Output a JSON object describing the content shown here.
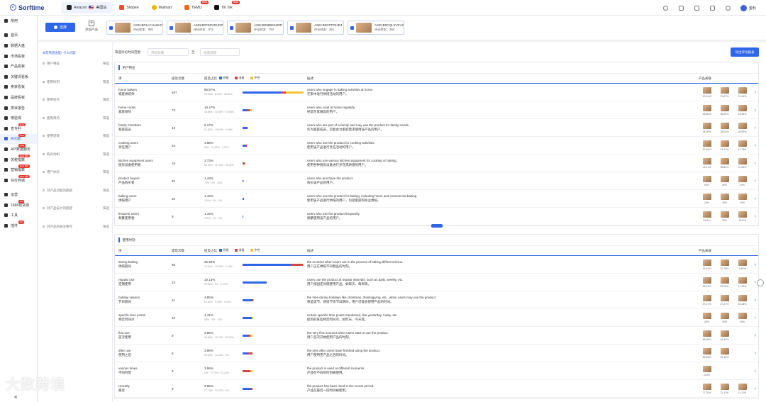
{
  "app": {
    "name": "Sorftime"
  },
  "tabs": [
    {
      "label": "Amazon",
      "sub": "美国站",
      "color": "#222"
    },
    {
      "label": "Shopee",
      "color": "#ee4d2d"
    },
    {
      "label": "Walmart",
      "color": "#f2b400"
    },
    {
      "label": "TEMU",
      "badge": "Beta",
      "color": "#f26522"
    },
    {
      "label": "Tik Tok",
      "badge": "Beta",
      "color": "#111"
    }
  ],
  "user": {
    "name": "金科"
  },
  "sidebar": {
    "items": [
      {
        "label": "常用"
      },
      {
        "label": "首页"
      },
      {
        "label": "数据大盘"
      },
      {
        "label": "市场看板"
      },
      {
        "label": "产品看板"
      },
      {
        "label": "关键词看板"
      },
      {
        "label": "卖家看板"
      },
      {
        "label": "品牌看板"
      },
      {
        "label": "类目报告"
      },
      {
        "label": "榜验得"
      },
      {
        "label": "查专利",
        "badge": "New"
      },
      {
        "label": "AI功能",
        "badge": "New"
      },
      {
        "label": "API数据服务",
        "badge": "New"
      },
      {
        "label": "关税指数",
        "badge": "New 5周"
      },
      {
        "label": "营销指数",
        "badge": "New 5周"
      },
      {
        "label": "任价商城",
        "badge": "New 5周"
      },
      {
        "label": "运营"
      },
      {
        "label": "1688找货源",
        "badge": "hot"
      },
      {
        "label": "工具"
      },
      {
        "label": "插件",
        "badge": "hot"
      }
    ]
  },
  "toolbar": {
    "choose_label": "选择",
    "add_label": "添加产品"
  },
  "products": [
    {
      "asin": "ASIN:B01ACUA8HC",
      "count_label": "评论样本：",
      "count": "905"
    },
    {
      "asin": "ASIN:B07DZVRURZ",
      "count_label": "评论样本：",
      "count": "872"
    },
    {
      "asin": "ASIN:B098B5S4RR",
      "count_label": "评论样本：",
      "count": "783"
    },
    {
      "asin": "ASIN:B0CFTP6JR4",
      "count_label": "评论样本：",
      "count": "392"
    },
    {
      "asin": "ASIN:B0CQLXVKV2",
      "count_label": "评论样本：",
      "count": "386"
    }
  ],
  "left_panel": {
    "hint": "如何筛选维度? 什么问题",
    "rows": [
      {
        "label": "用户特征",
        "action": "筛选"
      },
      {
        "label": "使用时刻",
        "action": "筛选"
      },
      {
        "label": "使用地点",
        "action": "筛选"
      },
      {
        "label": "使用目的",
        "action": "筛选"
      },
      {
        "label": "使用场景",
        "action": "筛选"
      },
      {
        "label": "购买动机",
        "action": "筛选"
      },
      {
        "label": "用户体验",
        "action": "筛选"
      },
      {
        "label": "对产品功能的期望",
        "action": "筛选"
      },
      {
        "label": "对产品设计的期望",
        "action": "筛选"
      },
      {
        "label": "对产品的关注要点",
        "action": "筛选"
      }
    ]
  },
  "filter": {
    "label": "筛选评论时间范围",
    "start_placeholder": "开始日期",
    "to": "至",
    "end_placeholder": "结束日期",
    "export": "导出评论报表"
  },
  "table_headers": {
    "item": "项",
    "count": "提及次数",
    "pct": "提及占比",
    "desc": "描述",
    "products": "产品关联",
    "legend": [
      {
        "label": "积极",
        "color": "#2f66e8"
      },
      {
        "label": "消极",
        "color": "#d64541"
      },
      {
        "label": "中性",
        "color": "#f4c430"
      }
    ]
  },
  "sections": [
    {
      "title": "用户特征",
      "rows": [
        {
          "en": "home bakers",
          "zh": "家庭烘焙师",
          "count": "487",
          "pct": "85.57%",
          "sub": "63.03% · 8.16% · 28.81%",
          "pos": 0.63,
          "neg": 0.08,
          "neu": 0.29,
          "bar": 1.0,
          "desc_en": "users who engage in baking activities at home.",
          "desc_zh": "在家中进行烘焙活动的用户。",
          "prod": [
            "20.04%",
            "19.67%",
            "19.44%"
          ]
        },
        {
          "en": "home cooks",
          "zh": "家庭厨师",
          "count": "73",
          "pct": "10.47%",
          "sub": "46.58% · 32.88% · 20.55%",
          "pos": 0.47,
          "neg": 0.33,
          "neu": 0.2,
          "bar": 0.15,
          "desc_en": "users who cook at home regularly.",
          "desc_zh": "经常在家做饭的用户。",
          "prod": [
            "46.58%",
            "34.25%",
            "15.44%"
          ]
        },
        {
          "en": "family members",
          "zh": "家庭成员",
          "count": "43",
          "pct": "6.17%",
          "sub": "81.82% · 13.64% · 4.55%",
          "pos": 0.82,
          "neg": 0.14,
          "neu": 0.04,
          "bar": 0.09,
          "desc_en": "users who are part of a family and may use the product for family needs.",
          "desc_zh": "作为家庭成员，可能会为家庭需求使用该产品的用户。",
          "prod": [
            "25.00%",
            "25.00%",
            "20.93%"
          ]
        },
        {
          "en": "cooking users",
          "zh": "烹饪用户",
          "count": "34",
          "pct": "4.88%",
          "sub": "88% · 11.63% · 0.37%",
          "pos": 0.88,
          "neg": 0.12,
          "neu": 0.0,
          "bar": 0.07,
          "desc_en": "users who use the product for cooking activities.",
          "desc_zh": "使用该产品进行烹饪活动的用户。",
          "prod": [
            "67.65%",
            "14.71%",
            "11.76%"
          ]
        },
        {
          "en": "kitchen equipment users",
          "zh": "厨房设备使用者",
          "count": "19",
          "pct": "2.73%",
          "sub": "52.42% · 21.36% · 26.22%",
          "pos": 0.52,
          "neg": 0.21,
          "neu": 0.27,
          "bar": 0.05,
          "desc_en": "users who use various kitchen equipment for cooking or baking.",
          "desc_zh": "使用各种厨房设备进行烹饪或烘焙的用户。",
          "prod": [
            "42.11%",
            "36.84%",
            "21.05%"
          ]
        },
        {
          "en": "product buyers",
          "zh": "产品购买者",
          "count": "10",
          "pct": "1.43%",
          "sub": "70% · 0% · 30%",
          "pos": 0.7,
          "neg": 0.0,
          "neu": 0.3,
          "bar": 0.02,
          "desc_en": "users who purchase the product.",
          "desc_zh": "购买该产品的用户。",
          "prod": [
            "50%",
            "30%",
            "10%"
          ]
        },
        {
          "en": "baking users",
          "zh": "烘焙用户",
          "count": "10",
          "pct": "1.43%",
          "sub": "100% · 0% · 0%",
          "pos": 1.0,
          "neg": 0.0,
          "neu": 0.0,
          "bar": 0.02,
          "desc_en": "users who use the product for baking, including home and commercial baking.",
          "desc_zh": "使用该产品进行烘焙的用户，包括家庭和商业烘焙。",
          "prod": [
            "20%",
            "30%",
            "20%"
          ]
        },
        {
          "en": "frequent users",
          "zh": "频繁使用者",
          "count": "8",
          "pct": "1.15%",
          "sub": "100% · 0% · 0%",
          "pos": 1.0,
          "neg": 0.0,
          "neu": 0.0,
          "bar": 0.015,
          "desc_en": "users who use the product frequently.",
          "desc_zh": "频繁使用该产品的用户。",
          "prod": [
            "62.5%",
            "25%",
            "12.5%"
          ]
        }
      ]
    },
    {
      "title": "使用时刻",
      "rows": [
        {
          "en": "during baking",
          "zh": "烘焙期间",
          "count": "58",
          "pct": "25.55%",
          "sub": "79.09% · 20.95% · 0.19%",
          "pos": 0.79,
          "neg": 0.2,
          "neu": 0.01,
          "bar": 1.0,
          "desc_en": "the moment when users are in the process of baking different items.",
          "desc_zh": "用户正在烘焙不同物品的时刻。",
          "prod": [
            "32.07%",
            "32.79%",
            "3.45%"
          ]
        },
        {
          "en": "regular use",
          "zh": "定期使用",
          "count": "23",
          "pct": "10.13%",
          "sub": "99.68% · 0% · 0.32%",
          "pos": 1.0,
          "neg": 0.0,
          "neu": 0.0,
          "bar": 0.4,
          "desc_en": "users use the product at regular intervals, such as daily, weekly, etc.",
          "desc_zh": "用户按固定间隔使用产品，如每天、每周等。",
          "prod": [
            "36.43%",
            "26.09%",
            "17.39%"
          ]
        },
        {
          "en": "holiday season",
          "zh": "节日期间",
          "count": "11",
          "pct": "4.85%",
          "sub": "81.82% · 9.09% · 9.09%",
          "pos": 0.82,
          "neg": 0.09,
          "neu": 0.09,
          "bar": 0.19,
          "desc_en": "the time during holidays like christmas, thanksgiving, etc., when users may use the product.",
          "desc_zh": "像圣诞节、感恩节等节日期间，用户可能会使用产品的时间。",
          "prod": [
            "27.27%",
            "27.27%",
            "18.18%"
          ]
        },
        {
          "en": "specific time points",
          "zh": "特定时间点",
          "count": "10",
          "pct": "4.41%",
          "sub": "88% · 0% · 12%",
          "pos": 0.88,
          "neg": 0.0,
          "neu": 0.12,
          "bar": 0.17,
          "desc_en": "certain specific time points mentioned, like yesterday, today, etc.",
          "desc_zh": "提到的某些特定时间点，如昨天、今天等。",
          "prod": [
            "40%",
            "30%",
            "20%"
          ]
        },
        {
          "en": "first use",
          "zh": "首次使用",
          "count": "9",
          "pct": "3.96%",
          "sub": "55.56% · 22.22% · 22.22%",
          "pos": 0.56,
          "neg": 0.22,
          "neu": 0.22,
          "bar": 0.16,
          "desc_en": "the very first moment when users start to use the product.",
          "desc_zh": "用户首次开始使用产品的时刻。",
          "prod": [
            "55.56%",
            "44.44%"
          ]
        },
        {
          "en": "after use",
          "zh": "使用之后",
          "count": "9",
          "pct": "3.96%",
          "sub": "55.56% · 44.44% · 0%",
          "pos": 0.56,
          "neg": 0.44,
          "neu": 0.0,
          "bar": 0.16,
          "desc_en": "the time after users have finished using the product.",
          "desc_zh": "用户使用完产品之后的时间。",
          "prod": [
            "55.56%",
            "44.44%"
          ]
        },
        {
          "en": "various times",
          "zh": "不同时刻",
          "count": "9",
          "pct": "3.96%",
          "sub": "0% · 77.78% · 22.22%",
          "pos": 0.0,
          "neg": 0.78,
          "neu": 0.22,
          "bar": 0.16,
          "desc_en": "the product is used at different moments.",
          "desc_zh": "产品在不同的时刻被使用。",
          "prod": [
            "100%"
          ]
        },
        {
          "en": "recently",
          "zh": "最近",
          "count": "9",
          "pct": "3.96%",
          "sub": "77.78% · 22.22% · 0%",
          "pos": 0.78,
          "neg": 0.22,
          "neu": 0.0,
          "bar": 0.16,
          "desc_en": "the product has been used in the recent period.",
          "desc_zh": "产品在最近一段时间被使用。",
          "prod": [
            "77.78%",
            "11.11%",
            "11.11%"
          ]
        }
      ]
    }
  ],
  "watermark": "大数跨境"
}
